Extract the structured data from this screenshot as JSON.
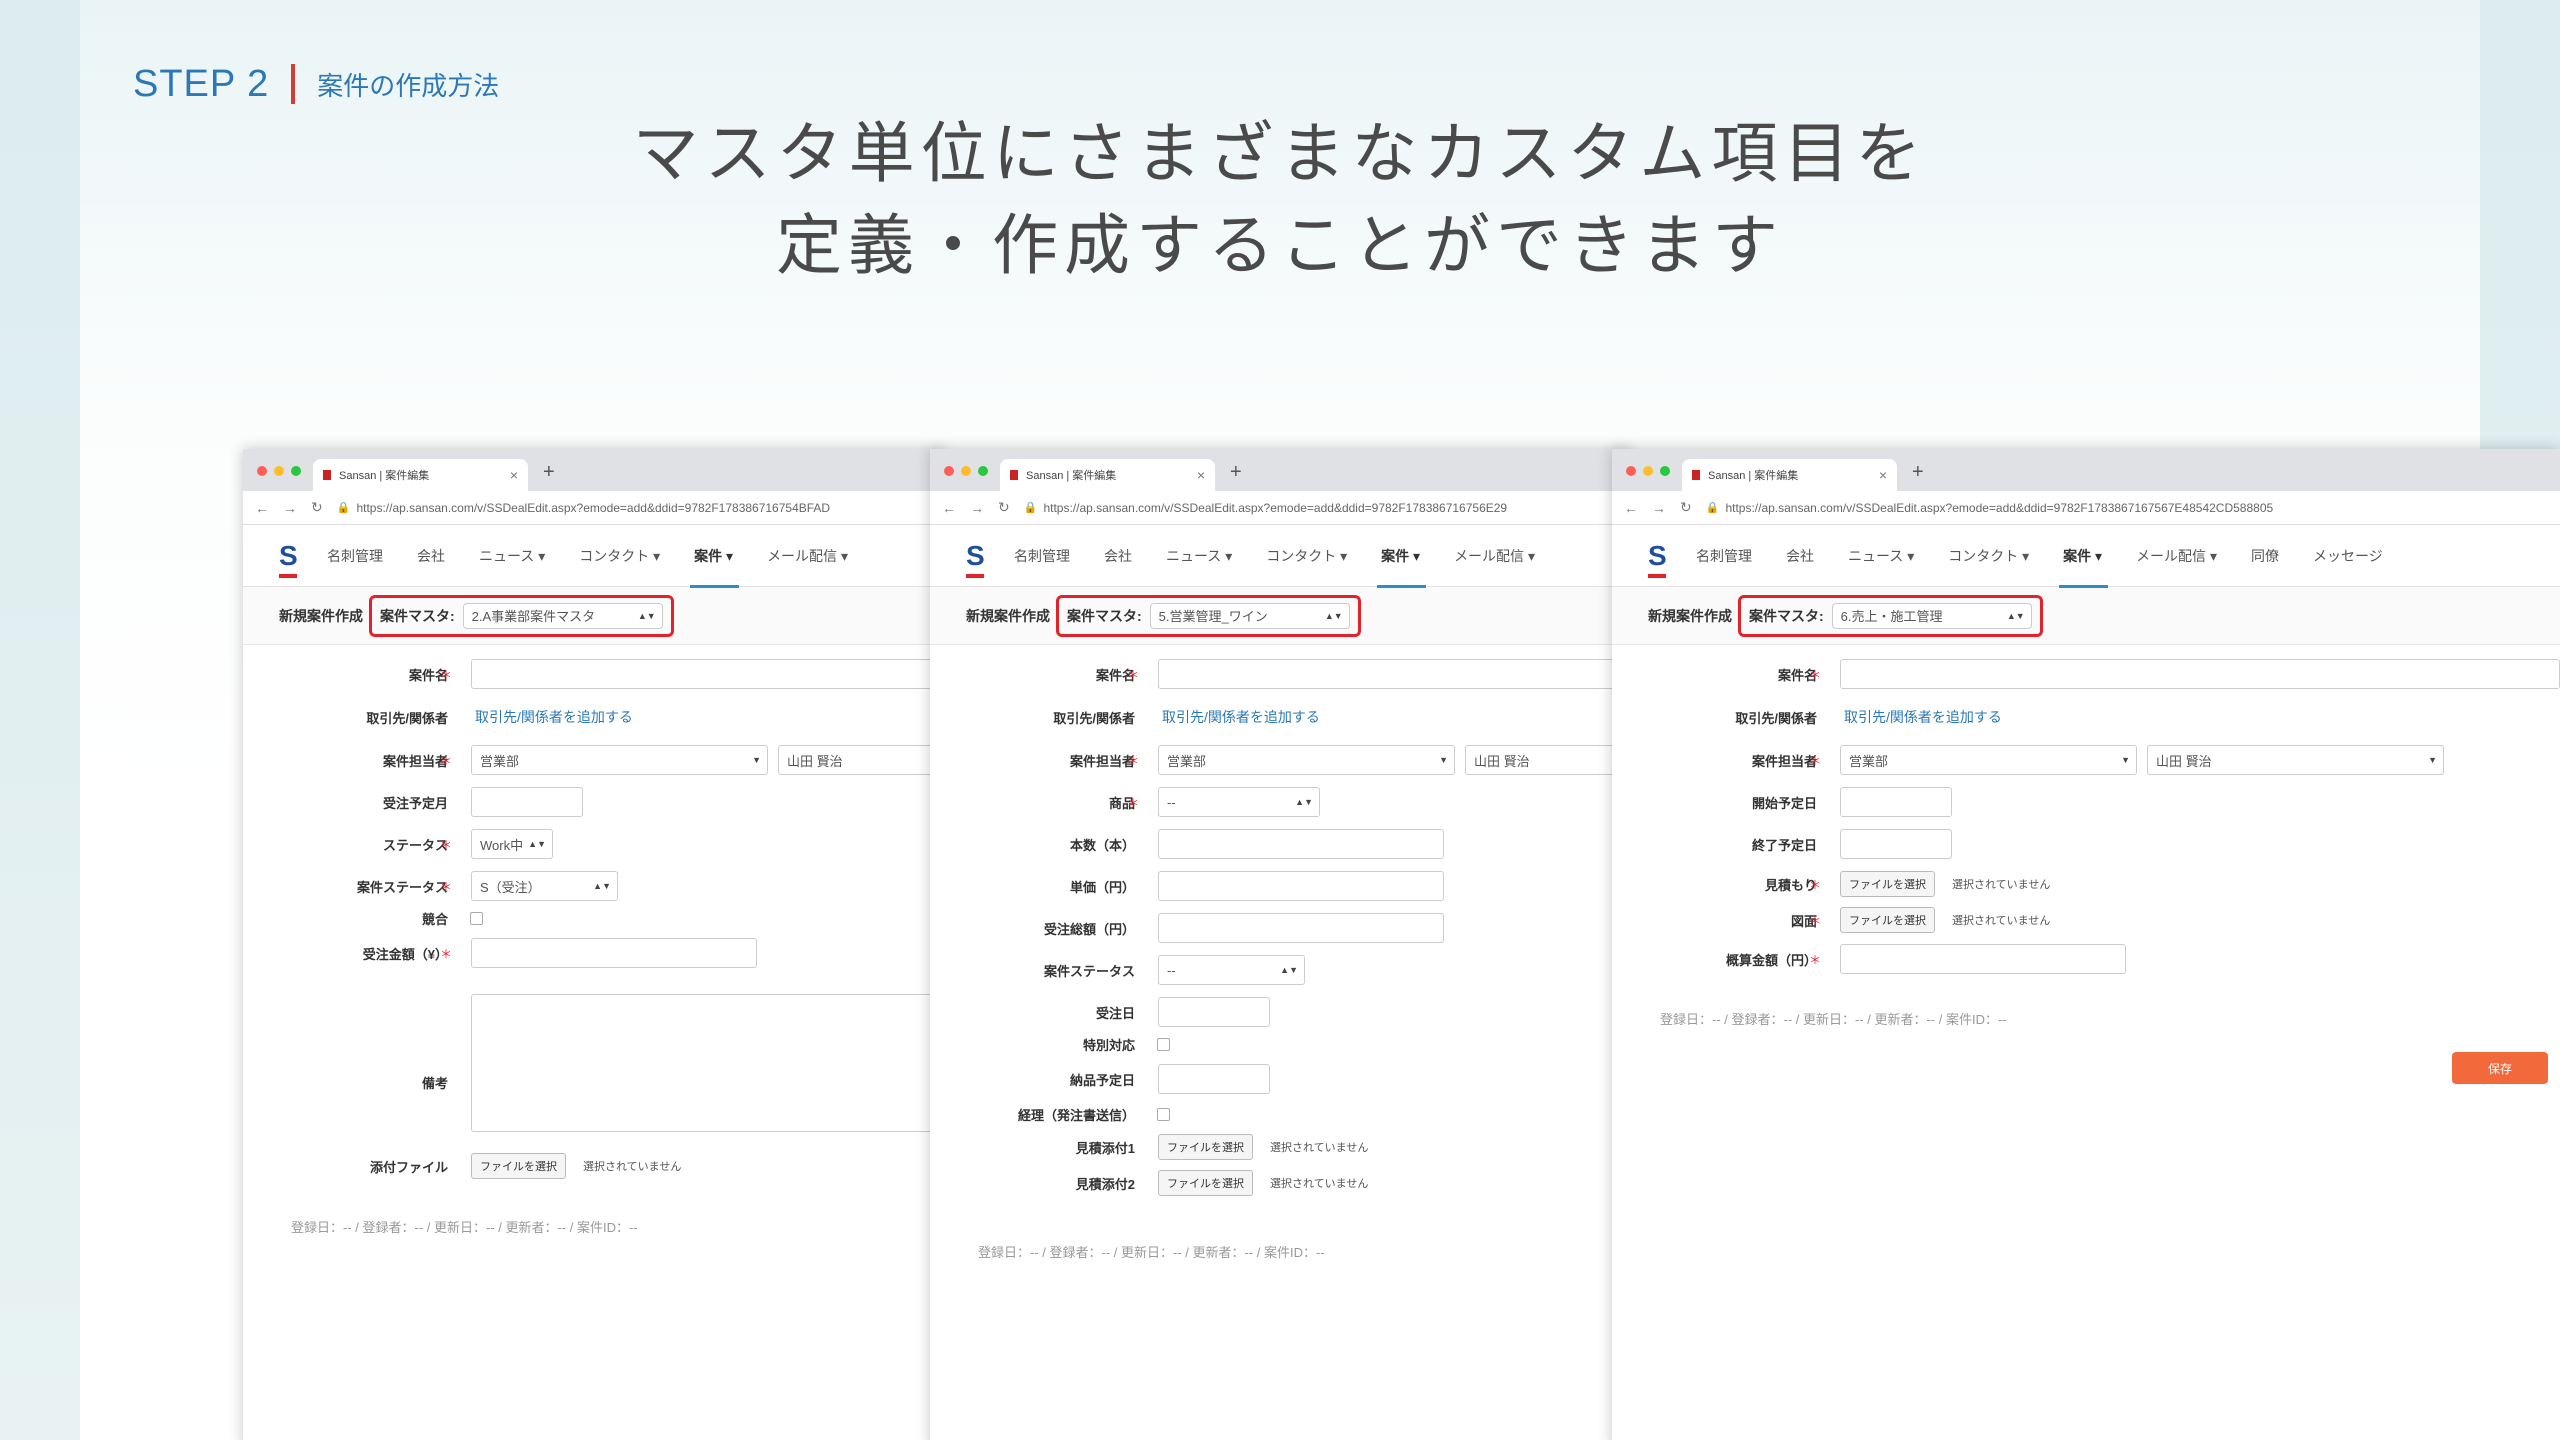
{
  "slide": {
    "step_label": "STEP 2",
    "step_subtitle": "案件の作成方法",
    "headline_line1": "マスタ単位にさまざまなカスタム項目を",
    "headline_line2": "定義・作成することができます",
    "accent_color": "#2a78b8",
    "divider_color": "#d43c3c"
  },
  "browser": {
    "tab_title": "Sansan | 案件編集",
    "url_1": "https://ap.sansan.com/v/SSDealEdit.aspx?emode=add&ddid=9782F178386716754BFAD",
    "url_2": "https://ap.sansan.com/v/SSDealEdit.aspx?emode=add&ddid=9782F178386716756E29",
    "url_3": "https://ap.sansan.com/v/SSDealEdit.aspx?emode=add&ddid=9782F1783867167567E48542CD588805"
  },
  "nav": {
    "logo": "S",
    "card_mgmt": "名刺管理",
    "company": "会社",
    "news": "ニュース ▾",
    "contact": "コンタクト ▾",
    "deal": "案件 ▾",
    "mail": "メール配信 ▾",
    "colleague": "同僚",
    "message": "メッセージ"
  },
  "form": {
    "new_deal_label": "新規案件作成",
    "master_label": "案件マスタ:",
    "not_selected": "選択されていません",
    "file_button": "ファイルを選択",
    "meta_footer": "登録日：-- / 登録者：-- / 更新日：-- / 更新者：-- / 案件ID：--",
    "save_label": "保存"
  },
  "windows": [
    {
      "master_value": "2.A事業部案件マスタ",
      "labels": {
        "deal_name": "案件名",
        "partner": "取引先/関係者",
        "owner": "案件担当者",
        "order_month": "受注予定月",
        "status": "ステータス",
        "deal_status": "案件ステータス",
        "competitor": "競合",
        "order_amount": "受注金額（¥）",
        "remarks": "備考",
        "attachment": "添付ファイル"
      },
      "partner_link": "取引先/関係者を追加する",
      "owner_dept": "営業部",
      "owner_person": "山田 賢治",
      "status_value": "Work中",
      "deal_status_value": "S（受注）"
    },
    {
      "master_value": "5.営業管理_ワイン",
      "labels": {
        "deal_name": "案件名",
        "partner": "取引先/関係者",
        "owner": "案件担当者",
        "product": "商品",
        "bottles": "本数（本）",
        "unit_price": "単価（円）",
        "total": "受注総額（円）",
        "deal_status": "案件ステータス",
        "order_date": "受注日",
        "special": "特別対応",
        "delivery": "納品予定日",
        "accounting": "経理（発注書送信）",
        "quote1": "見積添付1",
        "quote2": "見積添付2"
      },
      "partner_link": "取引先/関係者を追加する",
      "owner_dept": "営業部",
      "owner_person": "山田 賢治",
      "product_value": "--",
      "deal_status_value": "--"
    },
    {
      "master_value": "6.売上・施工管理",
      "labels": {
        "deal_name": "案件名",
        "partner": "取引先/関係者",
        "owner": "案件担当者",
        "start": "開始予定日",
        "end": "終了予定日",
        "estimate": "見積もり",
        "drawing": "図面",
        "approx": "概算金額（円）"
      },
      "partner_link": "取引先/関係者を追加する",
      "owner_dept": "営業部",
      "owner_person": "山田 賢治"
    }
  ]
}
